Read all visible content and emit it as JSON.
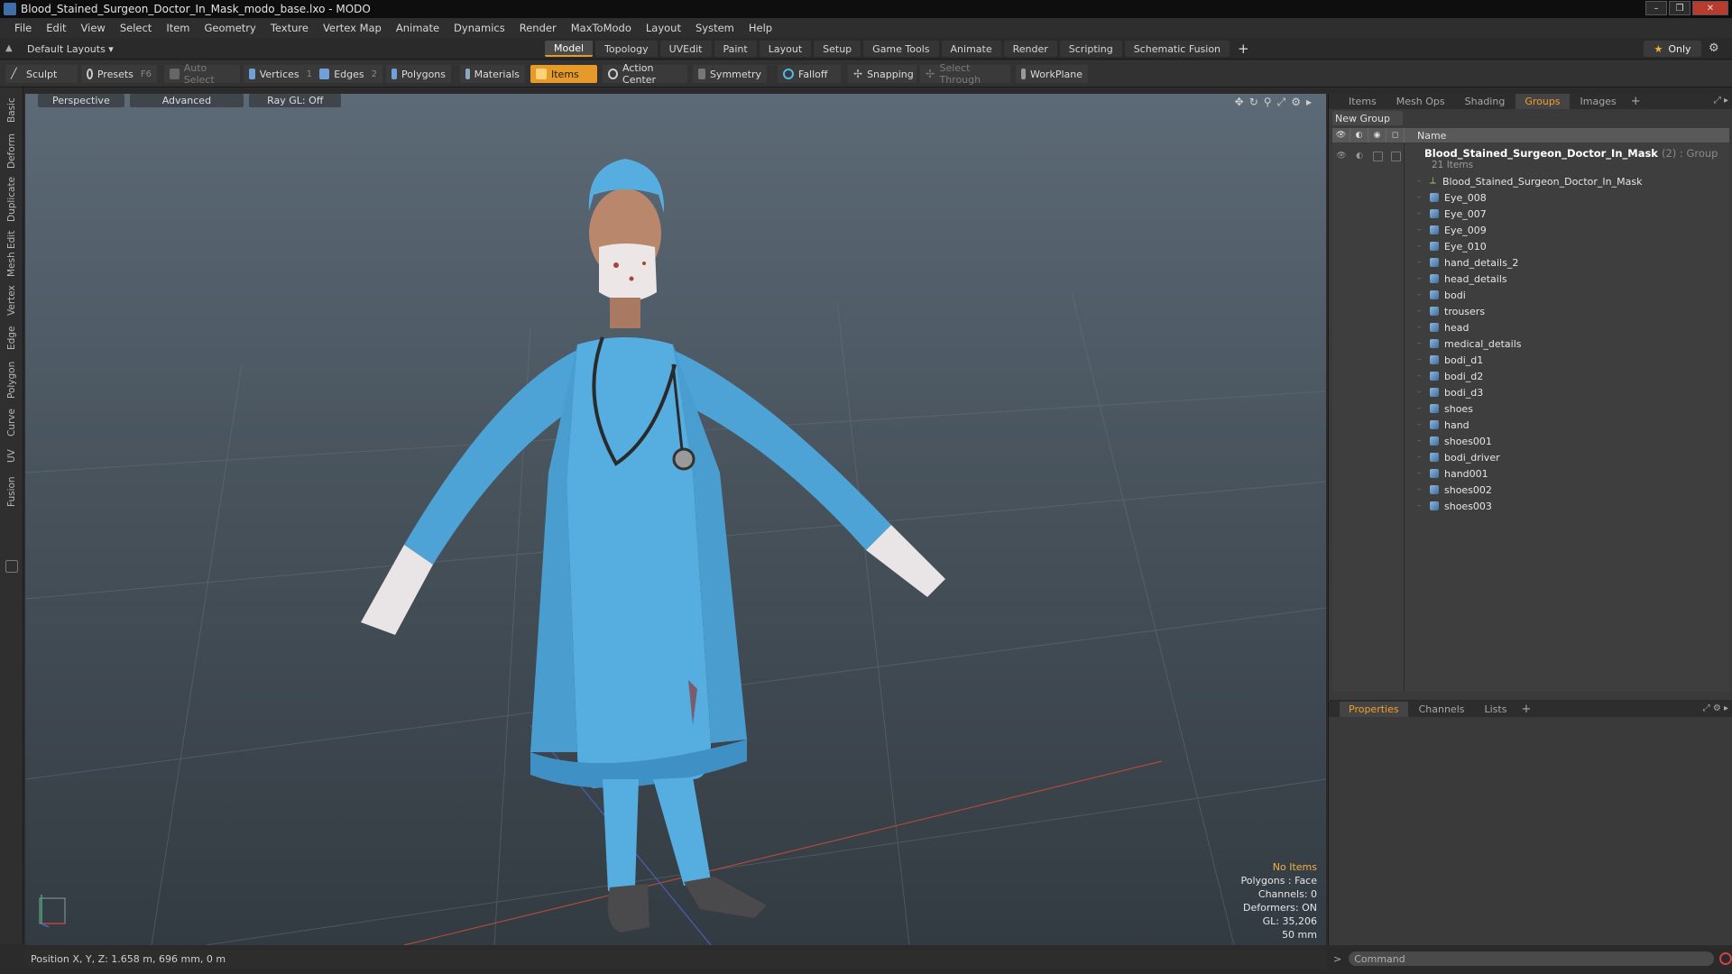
{
  "window": {
    "title": "Blood_Stained_Surgeon_Doctor_In_Mask_modo_base.lxo - MODO",
    "buttons": [
      "–",
      "❐",
      "✕"
    ]
  },
  "menu": [
    "File",
    "Edit",
    "View",
    "Select",
    "Item",
    "Geometry",
    "Texture",
    "Vertex Map",
    "Animate",
    "Dynamics",
    "Render",
    "MaxToModo",
    "Layout",
    "System",
    "Help"
  ],
  "layout": {
    "selector": "Default Layouts ▾",
    "tabs": [
      "Model",
      "Topology",
      "UVEdit",
      "Paint",
      "Layout",
      "Setup",
      "Game Tools",
      "Animate",
      "Render",
      "Scripting",
      "Schematic Fusion"
    ],
    "active_tab": "Model",
    "add": "+",
    "only": "Only"
  },
  "toolbar": {
    "sculpt": "Sculpt",
    "presets": "Presets",
    "presets_key": "F6",
    "auto_select": "Auto Select",
    "vertices": "Vertices",
    "vertices_count": "1",
    "edges": "Edges",
    "edges_count": "2",
    "polygons": "Polygons",
    "materials": "Materials",
    "items": "Items",
    "action_center": "Action Center",
    "symmetry": "Symmetry",
    "falloff": "Falloff",
    "snapping": "Snapping",
    "select_through": "Select Through",
    "workplane": "WorkPlane"
  },
  "left_tabs": [
    "Basic",
    "Deform",
    "Duplicate",
    "Mesh Edit",
    "Vertex",
    "Edge",
    "Polygon",
    "Curve",
    "UV",
    "Fusion"
  ],
  "viewport": {
    "view": "Perspective",
    "shading": "Advanced",
    "raygl": "Ray GL: Off",
    "stats": [
      "No Items",
      "Polygons : Face",
      "Channels: 0",
      "Deformers: ON",
      "GL: 35,206",
      "50 mm"
    ]
  },
  "status": {
    "position": "Position X, Y, Z:   1.658 m, 696 mm, 0 m"
  },
  "right_panel": {
    "tabs": [
      "Items",
      "Mesh Ops",
      "Shading",
      "Groups",
      "Images"
    ],
    "active_tab": "Groups",
    "add": "+",
    "new_group": "New Group",
    "name_header": "Name",
    "group_name": "Blood_Stained_Surgeon_Doctor_In_Mask",
    "group_count": "(2) : Group",
    "group_sub": "21 Items",
    "locator": "Blood_Stained_Surgeon_Doctor_In_Mask",
    "items": [
      "Eye_008",
      "Eye_007",
      "Eye_009",
      "Eye_010",
      "hand_details_2",
      "head_details",
      "bodi",
      "trousers",
      "head",
      "medical_details",
      "bodi_d1",
      "bodi_d2",
      "bodi_d3",
      "shoes",
      "hand",
      "shoes001",
      "bodi_driver",
      "hand001",
      "shoes002",
      "shoes003"
    ]
  },
  "bottom_panel": {
    "tabs": [
      "Properties",
      "Channels",
      "Lists"
    ],
    "active_tab": "Properties",
    "add": "+"
  },
  "command": {
    "prompt": ">",
    "placeholder": "Command"
  }
}
